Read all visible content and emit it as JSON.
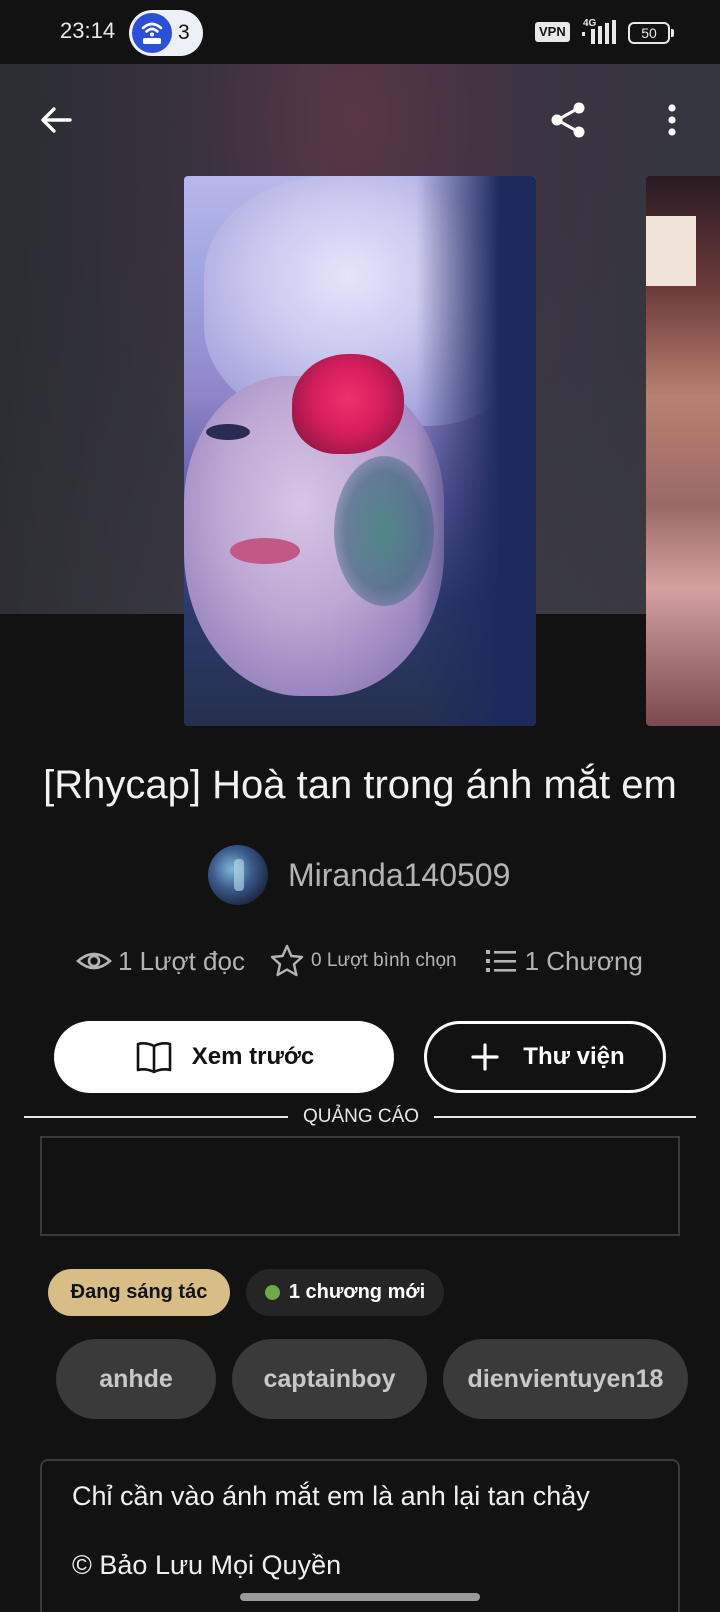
{
  "status_bar": {
    "time": "23:14",
    "notification_count": "3",
    "vpn_label": "VPN",
    "network_label": "4G",
    "battery_level": "50"
  },
  "book": {
    "title": "[Rhycap] Hoà tan trong ánh mắt em",
    "author": "Miranda140509"
  },
  "stats": {
    "reads": "1 Lượt đọc",
    "votes": "0 Lượt bình chọn",
    "chapters": "1 Chương"
  },
  "actions": {
    "preview_label": "Xem trước",
    "library_label": "Thư viện"
  },
  "ad": {
    "label": "QUẢNG CÁO"
  },
  "status_chips": {
    "status": "Đang sáng tác",
    "new_chapter": "1 chương mới"
  },
  "tags": [
    "anhde",
    "captainboy",
    "dienvientuyen18"
  ],
  "description": {
    "text": "Chỉ cần vào ánh mắt em là anh lại tan chảy",
    "copyright": "© Bảo Lưu Mọi Quyền"
  },
  "icons": {
    "back": "arrow-left-icon",
    "share": "share-icon",
    "more": "more-vertical-icon",
    "reads": "eye-icon",
    "votes": "star-icon",
    "chapters": "list-icon",
    "preview": "book-open-icon",
    "library": "plus-icon"
  },
  "colors": {
    "background": "#121212",
    "status_chip": "#d8bd86",
    "new_dot": "#6da945",
    "tag_bg": "#3a3a3a",
    "notif_accent": "#2b50d8"
  }
}
